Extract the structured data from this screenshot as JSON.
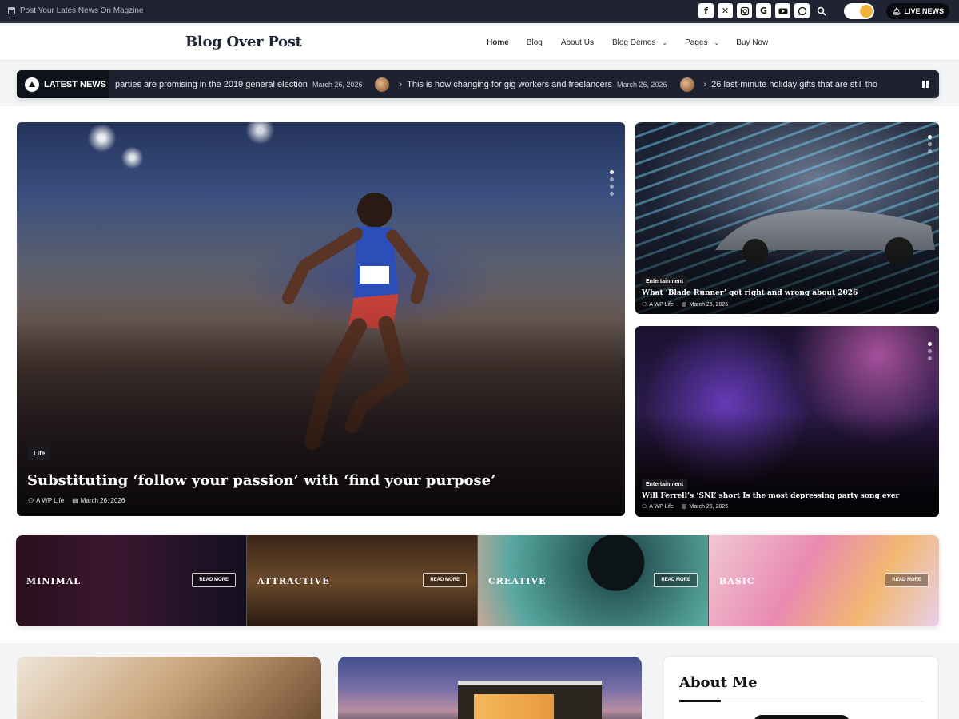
{
  "topbar": {
    "notice": "Post Your Lates News On Magzine",
    "socials": [
      "facebook-icon",
      "x-icon",
      "instagram-icon",
      "google-icon",
      "youtube-icon",
      "whatsapp-icon"
    ],
    "live_label": "LIVE NEWS"
  },
  "header": {
    "logo": "Blog Over Post",
    "nav": [
      {
        "label": "Home"
      },
      {
        "label": "Blog"
      },
      {
        "label": "About Us"
      },
      {
        "label": "Blog Demos"
      },
      {
        "label": "Pages"
      },
      {
        "label": "Buy Now"
      }
    ]
  },
  "ticker": {
    "label": "LATEST NEWS",
    "items": [
      {
        "title": "parties are promising in the 2019 general election",
        "date": "March 26, 2026"
      },
      {
        "title": "This is how changing for gig workers and freelancers",
        "date": "March 26, 2026"
      },
      {
        "title": "26 last-minute holiday gifts that are still tho",
        "date": ""
      }
    ]
  },
  "hero": {
    "category": "Life",
    "title": "Substituting ‘follow your passion’ with ‘find your purpose’",
    "author": "A WP Life",
    "date": "March 26, 2026"
  },
  "side_posts": [
    {
      "category": "Entertainment",
      "title": "What ‘Blade Runner’ got right and wrong about 2026",
      "author": "A WP Life",
      "date": "March 26, 2026"
    },
    {
      "category": "Entertainment",
      "title": "Will Ferrell’s ‘SNL’ short Is the most depressing party song ever",
      "author": "A WP Life",
      "date": "March 26, 2026"
    }
  ],
  "categories": [
    {
      "name": "MINIMAL",
      "button": "READ MORE"
    },
    {
      "name": "ATTRACTIVE",
      "button": "READ MORE"
    },
    {
      "name": "CREATIVE",
      "button": "READ MORE"
    },
    {
      "name": "BASIC",
      "button": "READ MORE"
    }
  ],
  "sidebar": {
    "about_title": "About Me"
  },
  "colors": {
    "topbar": "#202432",
    "accent": "#f1b23c",
    "dark": "#0f121b"
  }
}
